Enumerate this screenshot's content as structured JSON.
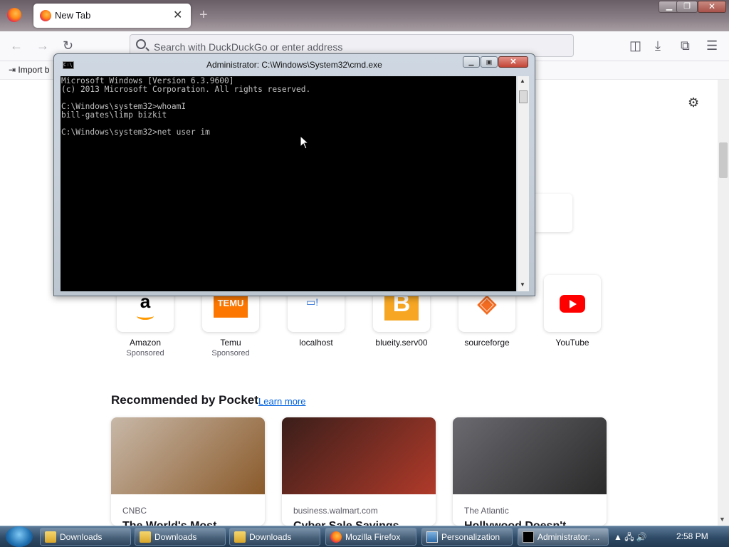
{
  "browser": {
    "tab_title": "New Tab",
    "tab_close": "✕",
    "new_tab": "+",
    "window_minimize": "▁",
    "window_restore": "❐",
    "window_close": "✕",
    "back": "←",
    "forward": "→",
    "reload": "↻",
    "url_placeholder": "Search with DuckDuckGo or enter address",
    "pocket_icon": "◫",
    "downloads_icon": "⤓",
    "extensions_icon": "⧉",
    "menu_icon": "☰",
    "bookmarks": {
      "import_label": "Import b"
    }
  },
  "newtab": {
    "settings_icon": "⚙",
    "shortcuts": [
      {
        "label": "Amazon",
        "sub": "Sponsored",
        "logo": "a"
      },
      {
        "label": "Temu",
        "sub": "Sponsored",
        "logo": "TEMU"
      },
      {
        "label": "localhost",
        "sub": "",
        "logo": "▭!"
      },
      {
        "label": "blueity.serv00",
        "sub": "",
        "logo": "B"
      },
      {
        "label": "sourceforge",
        "sub": "",
        "logo": "◈"
      },
      {
        "label": "YouTube",
        "sub": "",
        "logo": ""
      }
    ],
    "pocket": {
      "title": "Recommended by Pocket",
      "learn_more": "Learn more",
      "cards": [
        {
          "source": "CNBC",
          "headline": "The World's Most",
          "img_colors": [
            "#c8b8a8",
            "#8a5a2a"
          ]
        },
        {
          "source": "business.walmart.com",
          "headline": "Cyber Sale Savings",
          "img_colors": [
            "#3a1e1a",
            "#b03a2a"
          ]
        },
        {
          "source": "The Atlantic",
          "headline": "Hollywood Doesn't",
          "img_colors": [
            "#6a6a70",
            "#2a2a2a"
          ]
        }
      ]
    }
  },
  "cmd": {
    "icon_text": "C:\\",
    "title": "Administrator: C:\\Windows\\System32\\cmd.exe",
    "minimize": "▁",
    "maximize": "▣",
    "close": "✕",
    "console_lines": [
      "Microsoft Windows [Version 6.3.9600]",
      "(c) 2013 Microsoft Corporation. All rights reserved.",
      "",
      "C:\\Windows\\system32>whoamI",
      "bill-gates\\limp bizkit",
      "",
      "C:\\Windows\\system32>net user im"
    ],
    "scroll_up": "▲",
    "scroll_down": "▼"
  },
  "taskbar": {
    "items": [
      {
        "label": "Downloads",
        "icon": "folder"
      },
      {
        "label": "Downloads",
        "icon": "folder"
      },
      {
        "label": "Downloads",
        "icon": "folder"
      },
      {
        "label": "Mozilla Firefox",
        "icon": "firefox"
      },
      {
        "label": "Personalization",
        "icon": "personalization"
      },
      {
        "label": "Administrator: ...",
        "icon": "cmd"
      }
    ],
    "tray_icons": "▲  🖧  🔊",
    "clock": "2:58 PM"
  }
}
